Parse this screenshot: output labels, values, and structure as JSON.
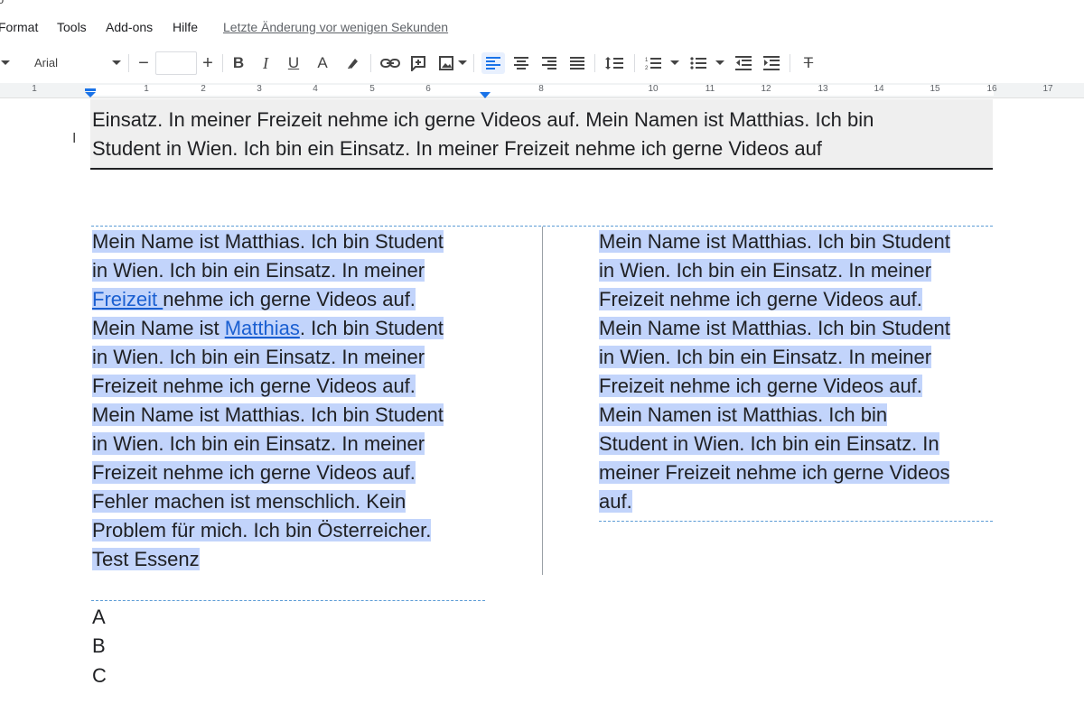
{
  "menu": {
    "items": [
      "Format",
      "Tools",
      "Add-ons",
      "Hilfe"
    ],
    "last_edit": "Letzte Änderung vor wenigen Sekunden"
  },
  "toolbar": {
    "font": "Arial",
    "font_size": "",
    "icons": [
      "font-dropdown-arrow",
      "decrease-font-size",
      "increase-font-size",
      "bold",
      "italic",
      "underline",
      "text-color",
      "highlight",
      "link",
      "comment",
      "image",
      "align-left",
      "align-center",
      "align-right",
      "justify",
      "line-spacing",
      "numbered-list",
      "bulleted-list",
      "decrease-indent",
      "increase-indent",
      "clear-formatting"
    ],
    "decrease_label": "−",
    "increase_label": "+",
    "bold_label": "B",
    "italic_label": "I",
    "underline_label": "U",
    "textcolor_label": "A",
    "clear_label": "T"
  },
  "ruler": {
    "numbers": [
      "1",
      "1",
      "2",
      "3",
      "4",
      "5",
      "6",
      "8",
      "10",
      "11",
      "12",
      "13",
      "14",
      "15",
      "16",
      "17"
    ]
  },
  "document": {
    "cursor_icon": "I",
    "header_lines": [
      "Einsatz. In meiner Freizeit nehme ich gerne Videos auf. Mein Namen ist Matthias. Ich bin",
      "Student in Wien. Ich bin ein Einsatz. In meiner Freizeit nehme ich gerne Videos auf"
    ],
    "left_column": {
      "l1": "Mein Name ist Matthias. Ich bin Student",
      "l2": "in Wien. Ich bin ein Einsatz. In meiner",
      "l3_link": "Freizeit ",
      "l3_rest": "nehme ich gerne Videos auf.",
      "l4_a": "Mein Name ist ",
      "l4_link": "Matthias",
      "l4_b": ". Ich bin Student",
      "l5": "in Wien. Ich bin ein Einsatz. In meiner",
      "l6": "Freizeit nehme ich gerne Videos auf.",
      "l7": "Mein Name ist Matthias. Ich bin Student",
      "l8": "in Wien. Ich bin ein Einsatz. In meiner",
      "l9": "Freizeit nehme ich gerne Videos auf.",
      "l10": "Fehler machen ist menschlich. Kein",
      "l11": "Problem für mich. Ich bin Österreicher.",
      "l12": "Test Essenz"
    },
    "right_column": {
      "l1": "Mein Name ist Matthias. Ich bin Student",
      "l2": "in Wien. Ich bin ein Einsatz. In meiner",
      "l3": "Freizeit nehme ich gerne Videos auf.",
      "l4": "Mein Name ist Matthias. Ich bin Student",
      "l5": "in Wien. Ich bin ein Einsatz. In meiner",
      "l6": "Freizeit nehme ich gerne Videos auf.",
      "l7": "Mein Namen ist Matthias. Ich bin",
      "l8": "Student in Wien. Ich bin ein Einsatz. In",
      "l9": "meiner Freizeit nehme ich gerne Videos",
      "l10": "auf."
    },
    "list": [
      "A",
      "B",
      "C"
    ]
  },
  "colors": {
    "selection": "#c2d4fb",
    "link": "#1a5fd1",
    "accent": "#1a73e8",
    "header_bg": "#efefef"
  }
}
